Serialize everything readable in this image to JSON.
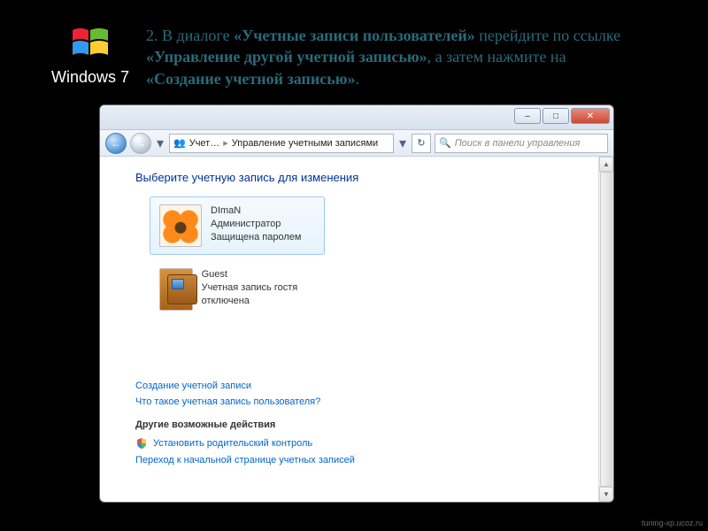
{
  "logo": {
    "text": "Windows 7"
  },
  "instruction": {
    "prefix": "2. В диалоге ",
    "b1": "«Учетные записи пользователей»",
    "mid1": " перейдите по ссылке ",
    "b2": "«Управление другой учетной записью»",
    "mid2": ", а затем нажмите на ",
    "b3": "«Создание учетной записью»",
    "suffix": "."
  },
  "window": {
    "caption": {
      "min": "–",
      "max": "□",
      "close": "✕"
    },
    "nav": {
      "breadcrumb_icon": "👥",
      "seg1": "Учет…",
      "seg2": "Управление учетными записями",
      "refresh": "↻",
      "search_placeholder": "Поиск в панели управления"
    },
    "heading": "Выберите учетную запись для изменения",
    "accounts": [
      {
        "name": "DImaN",
        "line2": "Администратор",
        "line3": "Защищена паролем",
        "avatar": "flower",
        "selected": true
      },
      {
        "name": "Guest",
        "line2": "Учетная запись гостя отключена",
        "line3": "",
        "avatar": "suitcase",
        "selected": false
      }
    ],
    "links": {
      "create": "Создание учетной записи",
      "whatis": "Что такое учетная запись пользователя?",
      "other_head": "Другие возможные действия",
      "parental": "Установить родительский контроль",
      "gohome": "Переход к начальной странице учетных записей"
    }
  },
  "watermark": "tuning-xp.ucoz.ru"
}
